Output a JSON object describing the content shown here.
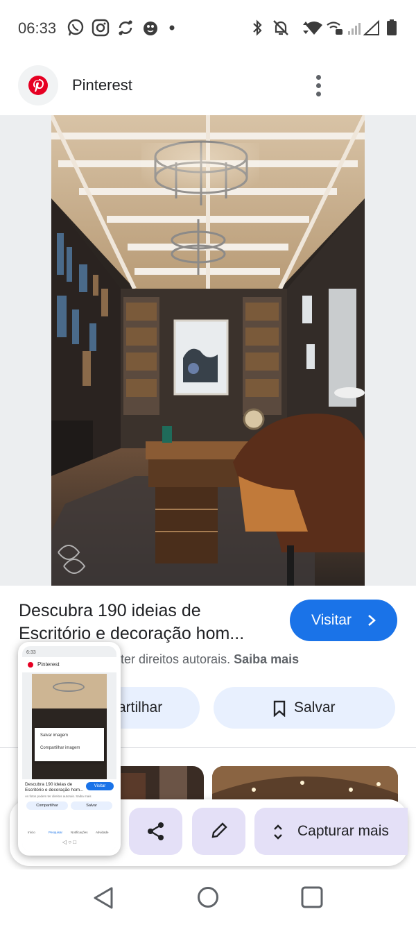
{
  "status_bar": {
    "time": "06:33",
    "left_icons": [
      "whatsapp-icon",
      "instagram-icon",
      "sync-icon",
      "bug-icon",
      "dot-icon"
    ],
    "right_icons": [
      "bluetooth-icon",
      "mute-icon",
      "data-arrows-icon",
      "wifi-icon",
      "wifi-calling-icon",
      "signal-weak-icon",
      "signal-empty-icon",
      "battery-icon"
    ]
  },
  "header": {
    "site_name": "Pinterest",
    "logo": "pinterest-logo-icon",
    "menu_icon": "more-vert-icon"
  },
  "result": {
    "title_line1": "Descubra 190 ideias de",
    "title_line2": "Escritório e decoração hom...",
    "visit_label": "Visitar",
    "copyright_text": "ter direitos autorais.",
    "learn_more": "Saiba mais",
    "share_label": "artilhar",
    "save_label": "Salvar"
  },
  "capture_toolbar": {
    "share_icon": "share-icon",
    "edit_icon": "pencil-icon",
    "expand_icon": "expand-vertical-icon",
    "capture_more_label": "Capturar mais"
  },
  "preview": {
    "status_text": "6:33",
    "site_name": "Pinterest",
    "menu_item_1": "Salvar imagem",
    "menu_item_2": "Compartilhar imagem",
    "title": "Descubra 190 ideias de Escritório e decoração hom...",
    "subtitle": "As fotos podem ter direitos autorais. Saiba mais",
    "visit_label": "Visitar",
    "share_label": "Compartilhar",
    "save_label": "Salvar",
    "nav": [
      "Início",
      "Pesquisar",
      "Notificações",
      "Atividade"
    ]
  },
  "colors": {
    "accent_blue": "#1a73e8",
    "chip_bg": "#e8f0fe",
    "capture_button_bg": "#e4e0f7",
    "pinterest_red": "#e60023"
  }
}
